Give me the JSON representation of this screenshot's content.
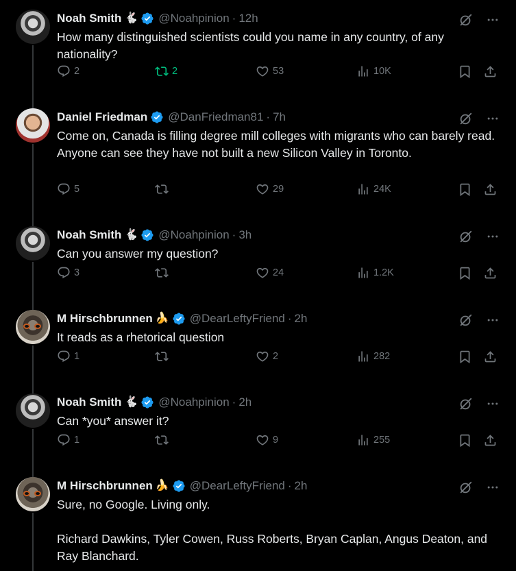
{
  "tweets": [
    {
      "name": "Noah Smith",
      "emoji": "🐇",
      "handle": "@Noahpinion",
      "time": "12h",
      "text": "How many distinguished scientists could you name in any country, of any nationality?",
      "replies": "2",
      "retweets": "2",
      "likes": "53",
      "views": "10K",
      "retweeted": true,
      "avatar": "noah"
    },
    {
      "name": "Daniel Friedman",
      "emoji": "",
      "handle": "@DanFriedman81",
      "time": "7h",
      "text": "Come on, Canada is filling degree mill colleges with migrants who can barely read. Anyone can see they have not built a new Silicon Valley in Toronto.",
      "replies": "5",
      "retweets": "",
      "likes": "29",
      "views": "24K",
      "retweeted": false,
      "avatar": "daniel"
    },
    {
      "name": "Noah Smith",
      "emoji": "🐇",
      "handle": "@Noahpinion",
      "time": "3h",
      "text": "Can you answer my question?",
      "replies": "3",
      "retweets": "",
      "likes": "24",
      "views": "1.2K",
      "retweeted": false,
      "avatar": "noah"
    },
    {
      "name": "M Hirschbrunnen",
      "emoji": "🍌",
      "handle": "@DearLeftyFriend",
      "time": "2h",
      "text": "It reads as a rhetorical question",
      "replies": "1",
      "retweets": "",
      "likes": "2",
      "views": "282",
      "retweeted": false,
      "avatar": "mh"
    },
    {
      "name": "Noah Smith",
      "emoji": "🐇",
      "handle": "@Noahpinion",
      "time": "2h",
      "text": "Can *you* answer it?",
      "replies": "1",
      "retweets": "",
      "likes": "9",
      "views": "255",
      "retweeted": false,
      "avatar": "noah"
    },
    {
      "name": "M Hirschbrunnen",
      "emoji": "🍌",
      "handle": "@DearLeftyFriend",
      "time": "2h",
      "text": "Sure, no Google. Living only.\n\nRichard Dawkins, Tyler Cowen, Russ Roberts, Bryan Caplan, Angus Deaton, and Ray Blanchard.",
      "replies": "",
      "retweets": "",
      "likes": "",
      "views": "",
      "retweeted": false,
      "avatar": "mh"
    }
  ],
  "icons": {
    "reply": "reply-icon",
    "retweet": "retweet-icon",
    "like": "heart-icon",
    "views": "views-icon",
    "bookmark": "bookmark-icon",
    "share": "share-icon",
    "grok": "grok-icon",
    "more": "more-icon",
    "verified": "verified-badge-icon"
  },
  "colors": {
    "background": "#000000",
    "text": "#e7e9ea",
    "muted": "#71767b",
    "verified": "#1d9bf0",
    "retweet_active": "#00ba7c",
    "thread_line": "#333639"
  }
}
